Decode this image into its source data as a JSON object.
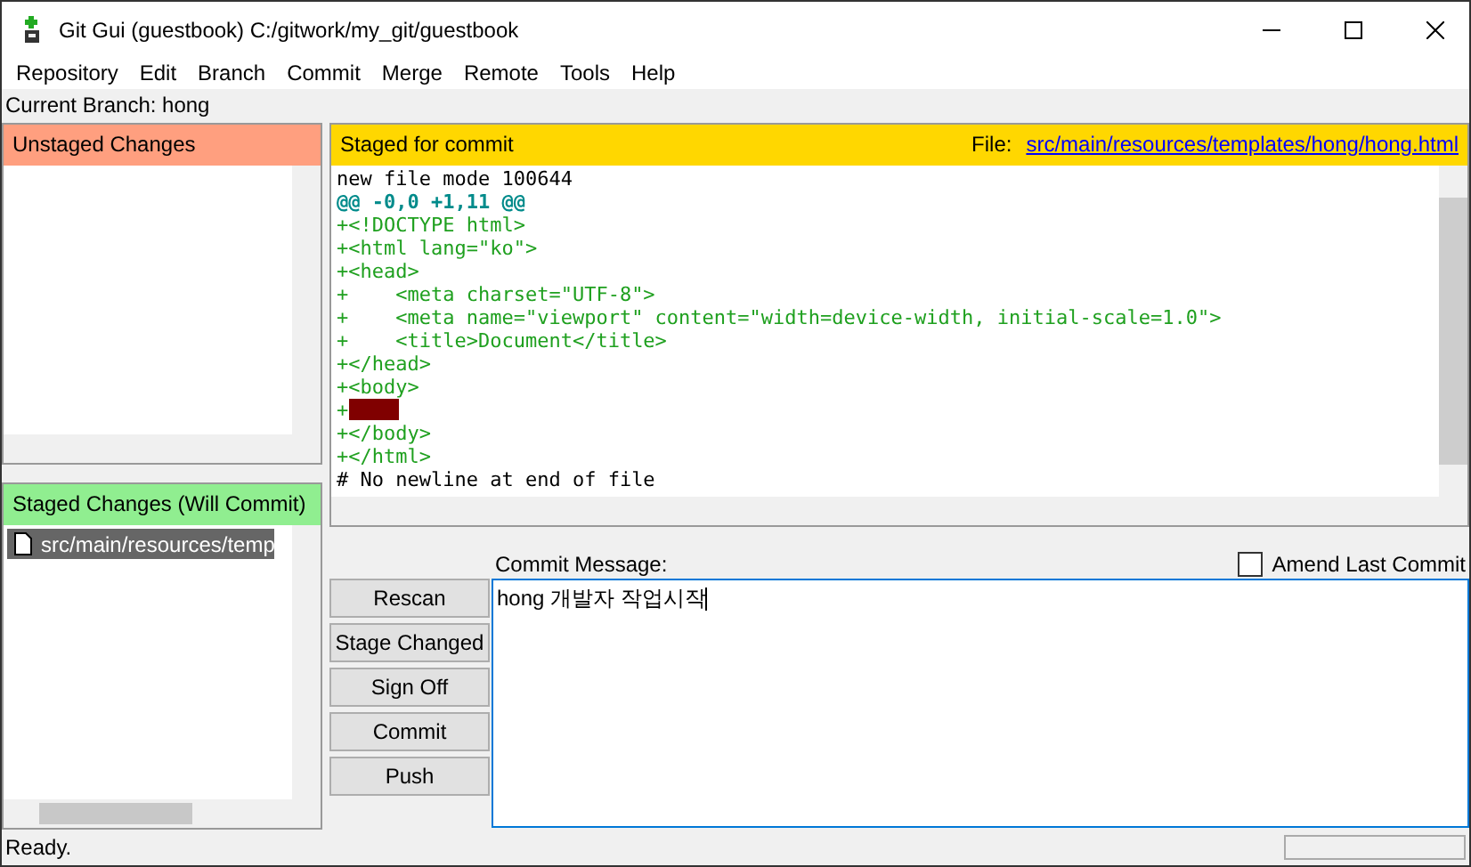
{
  "window": {
    "title": "Git Gui (guestbook) C:/gitwork/my_git/guestbook"
  },
  "menu": [
    "Repository",
    "Edit",
    "Branch",
    "Commit",
    "Merge",
    "Remote",
    "Tools",
    "Help"
  ],
  "current_branch": "Current Branch: hong",
  "unstaged": {
    "title": "Unstaged Changes"
  },
  "staged": {
    "title": "Staged Changes (Will Commit)",
    "files": [
      {
        "path": "src/main/resources/temp",
        "selected": true
      }
    ]
  },
  "diff": {
    "title": "Staged for commit",
    "file_label": "File:",
    "file_path": "src/main/resources/templates/hong/hong.html",
    "lines": [
      {
        "kind": "header",
        "text": "new file mode 100644"
      },
      {
        "kind": "hunk",
        "text": "@@ -0,0 +1,11 @@"
      },
      {
        "kind": "add",
        "text": "+<!DOCTYPE html>"
      },
      {
        "kind": "add",
        "text": "+<html lang=\"ko\">"
      },
      {
        "kind": "add",
        "text": "+<head>"
      },
      {
        "kind": "add",
        "text": "+    <meta charset=\"UTF-8\">"
      },
      {
        "kind": "add",
        "text": "+    <meta name=\"viewport\" content=\"width=device-width, initial-scale=1.0\">"
      },
      {
        "kind": "add",
        "text": "+    <title>Document</title>"
      },
      {
        "kind": "add",
        "text": "+</head>"
      },
      {
        "kind": "add",
        "text": "+<body>"
      },
      {
        "kind": "whitespace",
        "text": "+"
      },
      {
        "kind": "add",
        "text": "+</body>"
      },
      {
        "kind": "add",
        "text": "+</html>"
      },
      {
        "kind": "header",
        "text": "# No newline at end of file"
      }
    ]
  },
  "buttons": [
    "Rescan",
    "Stage Changed",
    "Sign Off",
    "Commit",
    "Push"
  ],
  "commit": {
    "label": "Commit Message:",
    "value": "hong 개발자 작업시작",
    "amend": {
      "label": "Amend Last Commit",
      "checked": false
    }
  },
  "status_bar": "Ready.",
  "progress": {
    "level": 0
  }
}
